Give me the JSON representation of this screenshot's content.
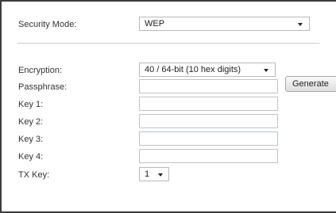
{
  "security_mode": {
    "label": "Security Mode:",
    "value": "WEP"
  },
  "encryption": {
    "label": "Encryption:",
    "value": "40 / 64-bit (10 hex digits)"
  },
  "passphrase": {
    "label": "Passphrase:",
    "value": "",
    "generate_label": "Generate"
  },
  "keys": [
    {
      "label": "Key 1:",
      "value": ""
    },
    {
      "label": "Key 2:",
      "value": ""
    },
    {
      "label": "Key 3:",
      "value": ""
    },
    {
      "label": "Key 4:",
      "value": ""
    }
  ],
  "tx_key": {
    "label": "TX Key:",
    "value": "1"
  },
  "icons": {
    "dropdown": "chevron-down-icon"
  }
}
